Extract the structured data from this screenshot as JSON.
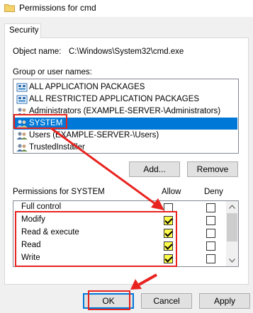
{
  "window": {
    "title": "Permissions for cmd"
  },
  "tabs": [
    {
      "label": "Security"
    }
  ],
  "object": {
    "label": "Object name:",
    "value": "C:\\Windows\\System32\\cmd.exe"
  },
  "groups": {
    "label": "Group or user names:",
    "items": [
      {
        "label": "ALL APPLICATION PACKAGES",
        "icon": "package-group-icon"
      },
      {
        "label": "ALL RESTRICTED APPLICATION PACKAGES",
        "icon": "package-group-icon"
      },
      {
        "label": "Administrators (EXAMPLE-SERVER-\\Administrators)",
        "icon": "user-group-icon"
      },
      {
        "label": "SYSTEM",
        "icon": "user-group-icon",
        "selected": true
      },
      {
        "label": "Users (EXAMPLE-SERVER-\\Users)",
        "icon": "user-group-icon"
      },
      {
        "label": "TrustedInstaller",
        "icon": "user-group-icon"
      }
    ]
  },
  "buttons": {
    "add": "Add...",
    "remove": "Remove",
    "ok": "OK",
    "cancel": "Cancel",
    "apply": "Apply"
  },
  "permissions": {
    "label": "Permissions for SYSTEM",
    "allow_header": "Allow",
    "deny_header": "Deny",
    "rows": [
      {
        "name": "Full control",
        "allow": false,
        "deny": false
      },
      {
        "name": "Modify",
        "allow": true,
        "deny": false
      },
      {
        "name": "Read & execute",
        "allow": true,
        "deny": false
      },
      {
        "name": "Read",
        "allow": true,
        "deny": false
      },
      {
        "name": "Write",
        "allow": true,
        "deny": false
      }
    ]
  },
  "colors": {
    "annotation": "#e8231f",
    "selection": "#0078d7",
    "checked_highlight": "#fdfb4a"
  }
}
